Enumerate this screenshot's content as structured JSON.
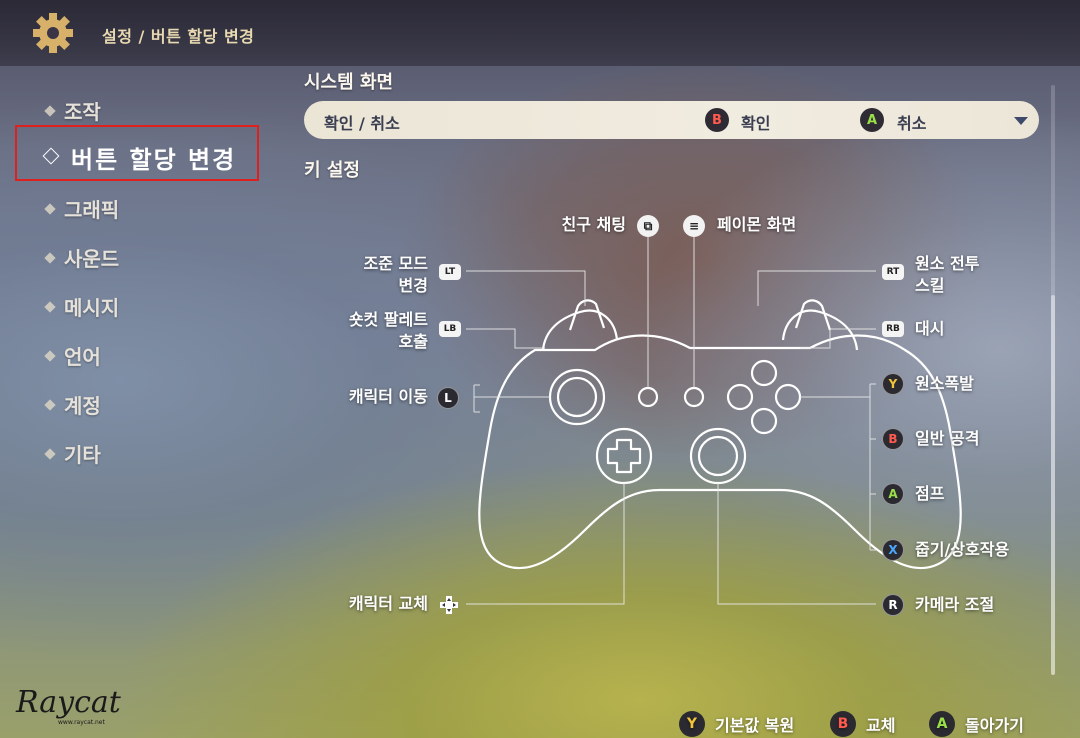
{
  "header": {
    "breadcrumb": "설정 / 버튼 할당 변경",
    "icon": "gear-icon"
  },
  "sidebar": {
    "items": [
      {
        "label": "조작"
      },
      {
        "label": "버튼 할당 변경",
        "active": true
      },
      {
        "label": "그래픽"
      },
      {
        "label": "사운드"
      },
      {
        "label": "메시지"
      },
      {
        "label": "언어"
      },
      {
        "label": "계정"
      },
      {
        "label": "기타"
      }
    ]
  },
  "system": {
    "title": "시스템 화면",
    "option_label": "확인 / 취소",
    "confirm_button": "B",
    "confirm_label": "확인",
    "cancel_button": "A",
    "cancel_label": "취소"
  },
  "keys": {
    "title": "키 설정",
    "friend_chat": "친구 채팅",
    "paimon_menu": "페이몬 화면",
    "aim_mode_1": "조준 모드",
    "aim_mode_2": "변경",
    "shortcut_1": "숏컷 팔레트",
    "shortcut_2": "호출",
    "move": "캐릭터 이동",
    "switch": "캐릭터 교체",
    "burst_1": "원소 전투",
    "burst_2": "스킬",
    "dash": "대시",
    "elemental_burst": "원소폭발",
    "normal_attack": "일반 공격",
    "jump": "점프",
    "pickup": "줍기/상호작용",
    "camera": "카메라 조절",
    "tag_lt": "LT",
    "tag_lb": "LB",
    "tag_rt": "RT",
    "tag_rb": "RB",
    "btn_l": "L",
    "btn_r": "R",
    "btn_y": "Y",
    "btn_b": "B",
    "btn_a": "A",
    "btn_x": "X"
  },
  "footer": {
    "reset_button": "Y",
    "reset_label": "기본값 복원",
    "swap_button": "B",
    "swap_label": "교체",
    "back_button": "A",
    "back_label": "돌아가기"
  },
  "watermark": {
    "text": "Raycat",
    "url": "www.raycat.net"
  },
  "colors": {
    "btn_a": "#9adf4a",
    "btn_b": "#ff5a4e",
    "btn_x": "#4aa8ff",
    "btn_y": "#f0c43a",
    "highlight_border": "#e01f1f"
  }
}
